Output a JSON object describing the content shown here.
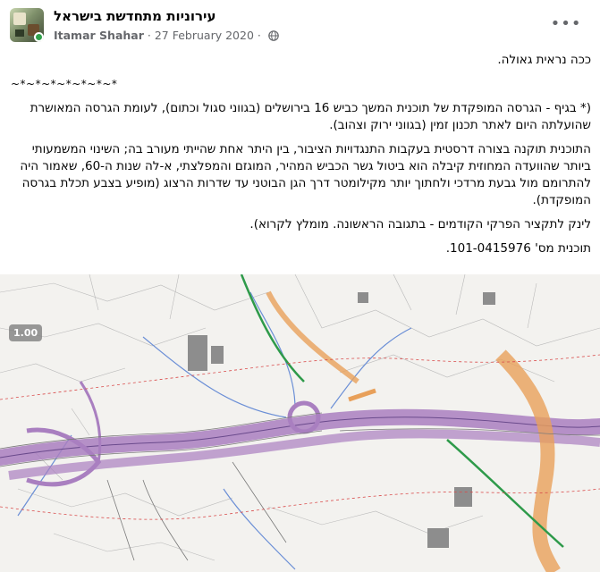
{
  "header": {
    "group_name": "עירוניות מתחדשת בישראל",
    "author": "Itamar Shahar",
    "separator": "·",
    "date": "27 February 2020",
    "more_label": "•••"
  },
  "post": {
    "paragraphs": [
      "ככה נראית גאולה.",
      "(* בגיף - הגרסה המופקדת של תוכנית המשך כביש 16 בירושלים (בגווני סגול וכתום), לעומת הגרסה המאושרת שהועלתה היום לאתר תכנון זמין (בגווני ירוק וצהוב).",
      "התוכנית תוקנה בצורה דרסטית בעקבות התנגדויות הציבור, בין היתר אחת שהייתי מעורב בה; השינוי המשמעותי ביותר שהוועדה המחוזית קיבלה הוא ביטול גשר הכביש המהיר, המוגזם והמפלצתי, א-לה שנות ה-60, שאמור היה להתרומם מול גבעת מרדכי ולחתוך יותר מקילומטר דרך הגן הבוטני עד שדרות הרצוג (מופיע בצבע תכלת בגרסה המופקדת).",
      "לינק לתקציר הפרקי הקודמים - בתגובה הראשונה. מומלץ לקרוא).",
      "תוכנית מס' 101-0415976."
    ],
    "divider": "~*~*~*~*~*~*~*"
  },
  "image": {
    "zoom_badge": "1.00",
    "colors": {
      "purple": "#a97fc0",
      "orange": "#e8a05a",
      "green": "#2e9a4a",
      "blue": "#6b8fd6",
      "building": "#8d8d8d"
    }
  }
}
